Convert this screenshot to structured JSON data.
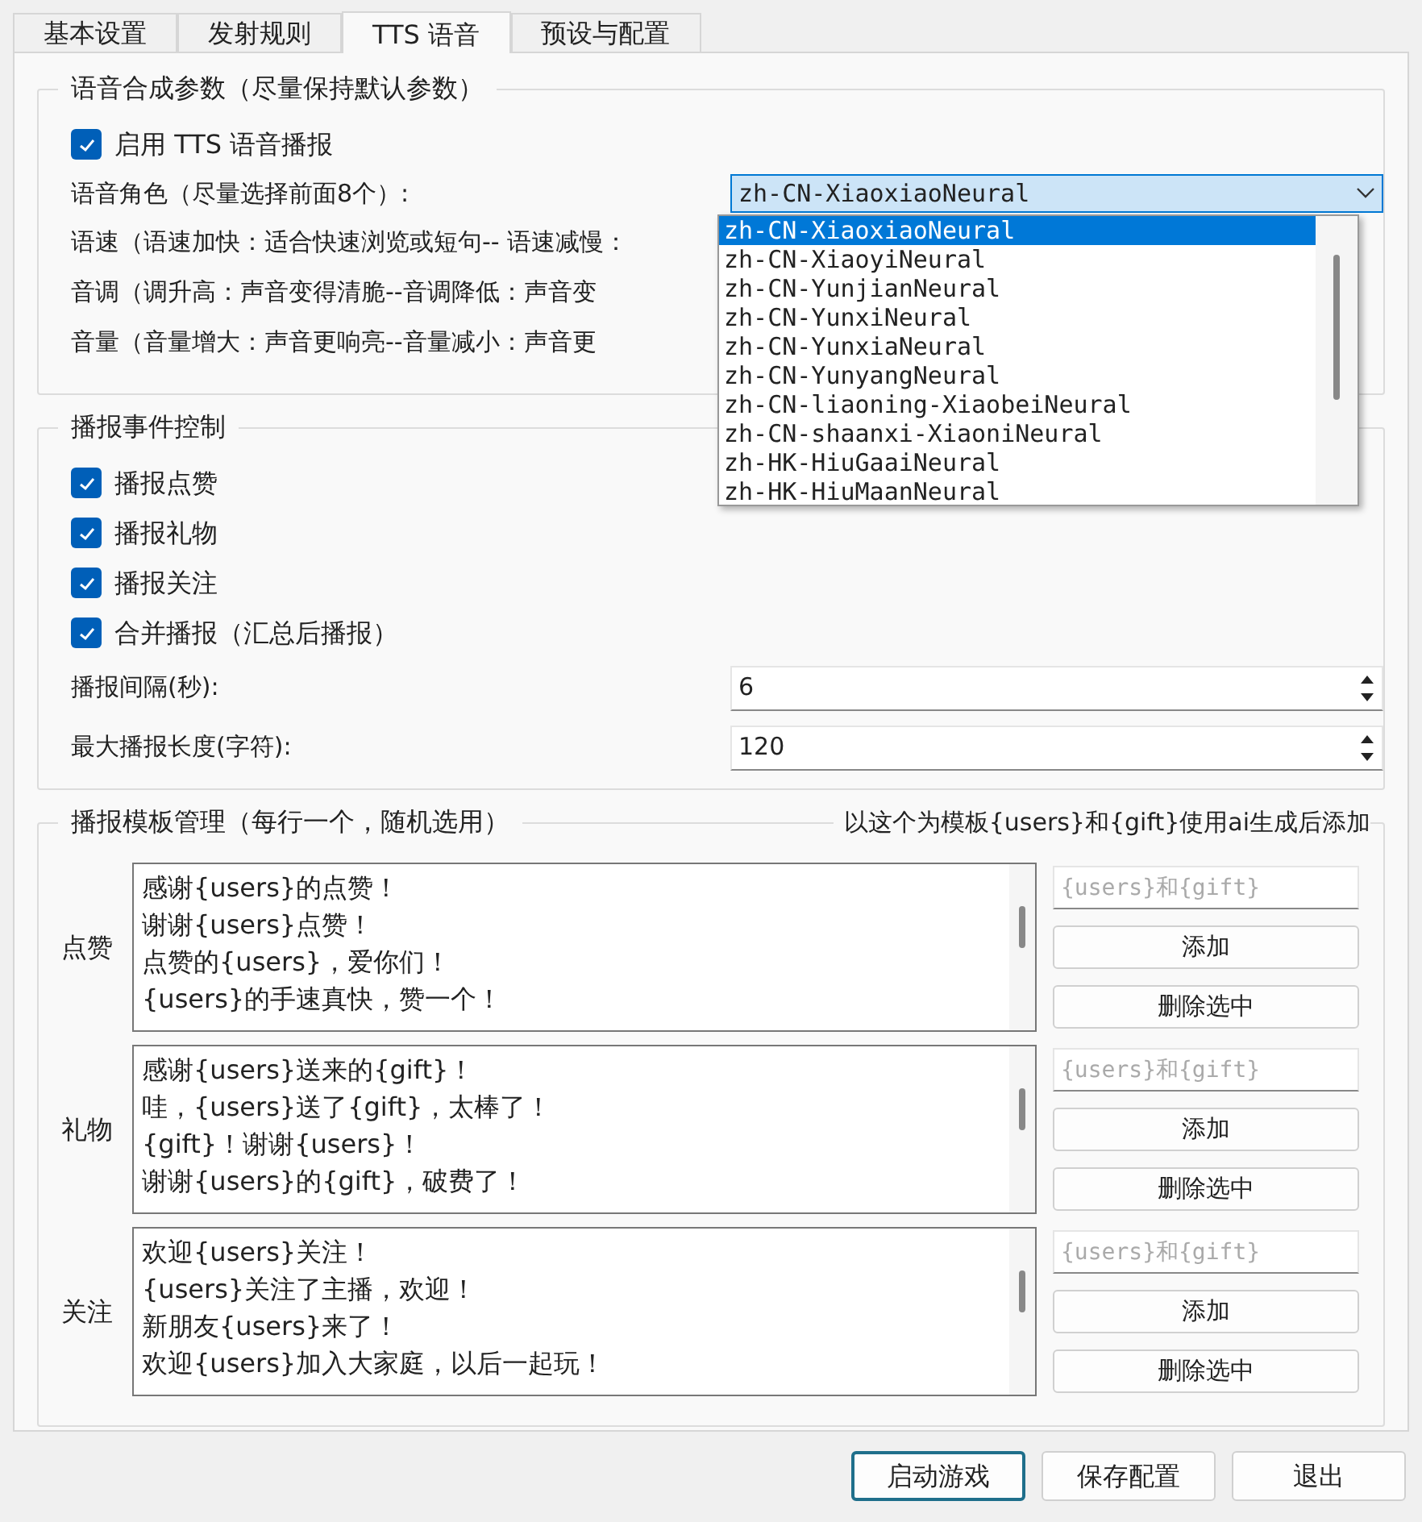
{
  "tabs": [
    {
      "label": "基本设置",
      "selected": false
    },
    {
      "label": "发射规则",
      "selected": false
    },
    {
      "label": "TTS 语音",
      "selected": true
    },
    {
      "label": "预设与配置",
      "selected": false
    }
  ],
  "synthesis": {
    "title": "语音合成参数（尽量保持默认参数）",
    "enable": {
      "label": "启用 TTS 语音播报",
      "checked": true
    },
    "voice": {
      "label": "语音角色（尽量选择前面8个）:",
      "value": "zh-CN-XiaoxiaoNeural",
      "expanded": true,
      "options": [
        {
          "label": "zh-CN-XiaoxiaoNeural",
          "selected": true
        },
        {
          "label": "zh-CN-XiaoyiNeural",
          "selected": false
        },
        {
          "label": "zh-CN-YunjianNeural",
          "selected": false
        },
        {
          "label": "zh-CN-YunxiNeural",
          "selected": false
        },
        {
          "label": "zh-CN-YunxiaNeural",
          "selected": false
        },
        {
          "label": "zh-CN-YunyangNeural",
          "selected": false
        },
        {
          "label": "zh-CN-liaoning-XiaobeiNeural",
          "selected": false
        },
        {
          "label": "zh-CN-shaanxi-XiaoniNeural",
          "selected": false
        },
        {
          "label": "zh-HK-HiuGaaiNeural",
          "selected": false
        },
        {
          "label": "zh-HK-HiuMaanNeural",
          "selected": false
        }
      ]
    },
    "hints": [
      "语速（语速加快：适合快速浏览或短句-- 语速减慢：",
      "音调（调升高：声音变得清脆--音调降低：声音变",
      "音量（音量增大：声音更响亮--音量减小：声音更"
    ]
  },
  "events": {
    "title": "播报事件控制",
    "checks": [
      {
        "label": "播报点赞",
        "checked": true
      },
      {
        "label": "播报礼物",
        "checked": true
      },
      {
        "label": "播报关注",
        "checked": true
      },
      {
        "label": "合并播报（汇总后播报）",
        "checked": true
      }
    ],
    "spins": [
      {
        "label": "播报间隔(秒):",
        "value": "6"
      },
      {
        "label": "最大播报长度(字符):",
        "value": "120"
      }
    ]
  },
  "templates": {
    "title": "播报模板管理（每行一个，随机选用）",
    "hint": "以这个为模板{users}和{gift}使用ai生成后添加",
    "groups": [
      {
        "label": "点赞",
        "lines": [
          "感谢{users}的点赞！",
          "谢谢{users}点赞！",
          "点赞的{users}，爱你们！",
          "{users}的手速真快，赞一个！"
        ],
        "placeholder": "{users}和{gift}",
        "add": "添加",
        "delete": "删除选中"
      },
      {
        "label": "礼物",
        "lines": [
          "感谢{users}送来的{gift}！",
          "哇，{users}送了{gift}，太棒了！",
          "{gift}！谢谢{users}！",
          "谢谢{users}的{gift}，破费了！"
        ],
        "placeholder": "{users}和{gift}",
        "add": "添加",
        "delete": "删除选中"
      },
      {
        "label": "关注",
        "lines": [
          "欢迎{users}关注！",
          "{users}关注了主播，欢迎！",
          "新朋友{users}来了！",
          "欢迎{users}加入大家庭，以后一起玩！"
        ],
        "placeholder": "{users}和{gift}",
        "add": "添加",
        "delete": "删除选中"
      }
    ]
  },
  "buttons": [
    {
      "label": "启动游戏",
      "focused": true
    },
    {
      "label": "保存配置",
      "focused": false
    },
    {
      "label": "退出",
      "focused": false
    }
  ]
}
